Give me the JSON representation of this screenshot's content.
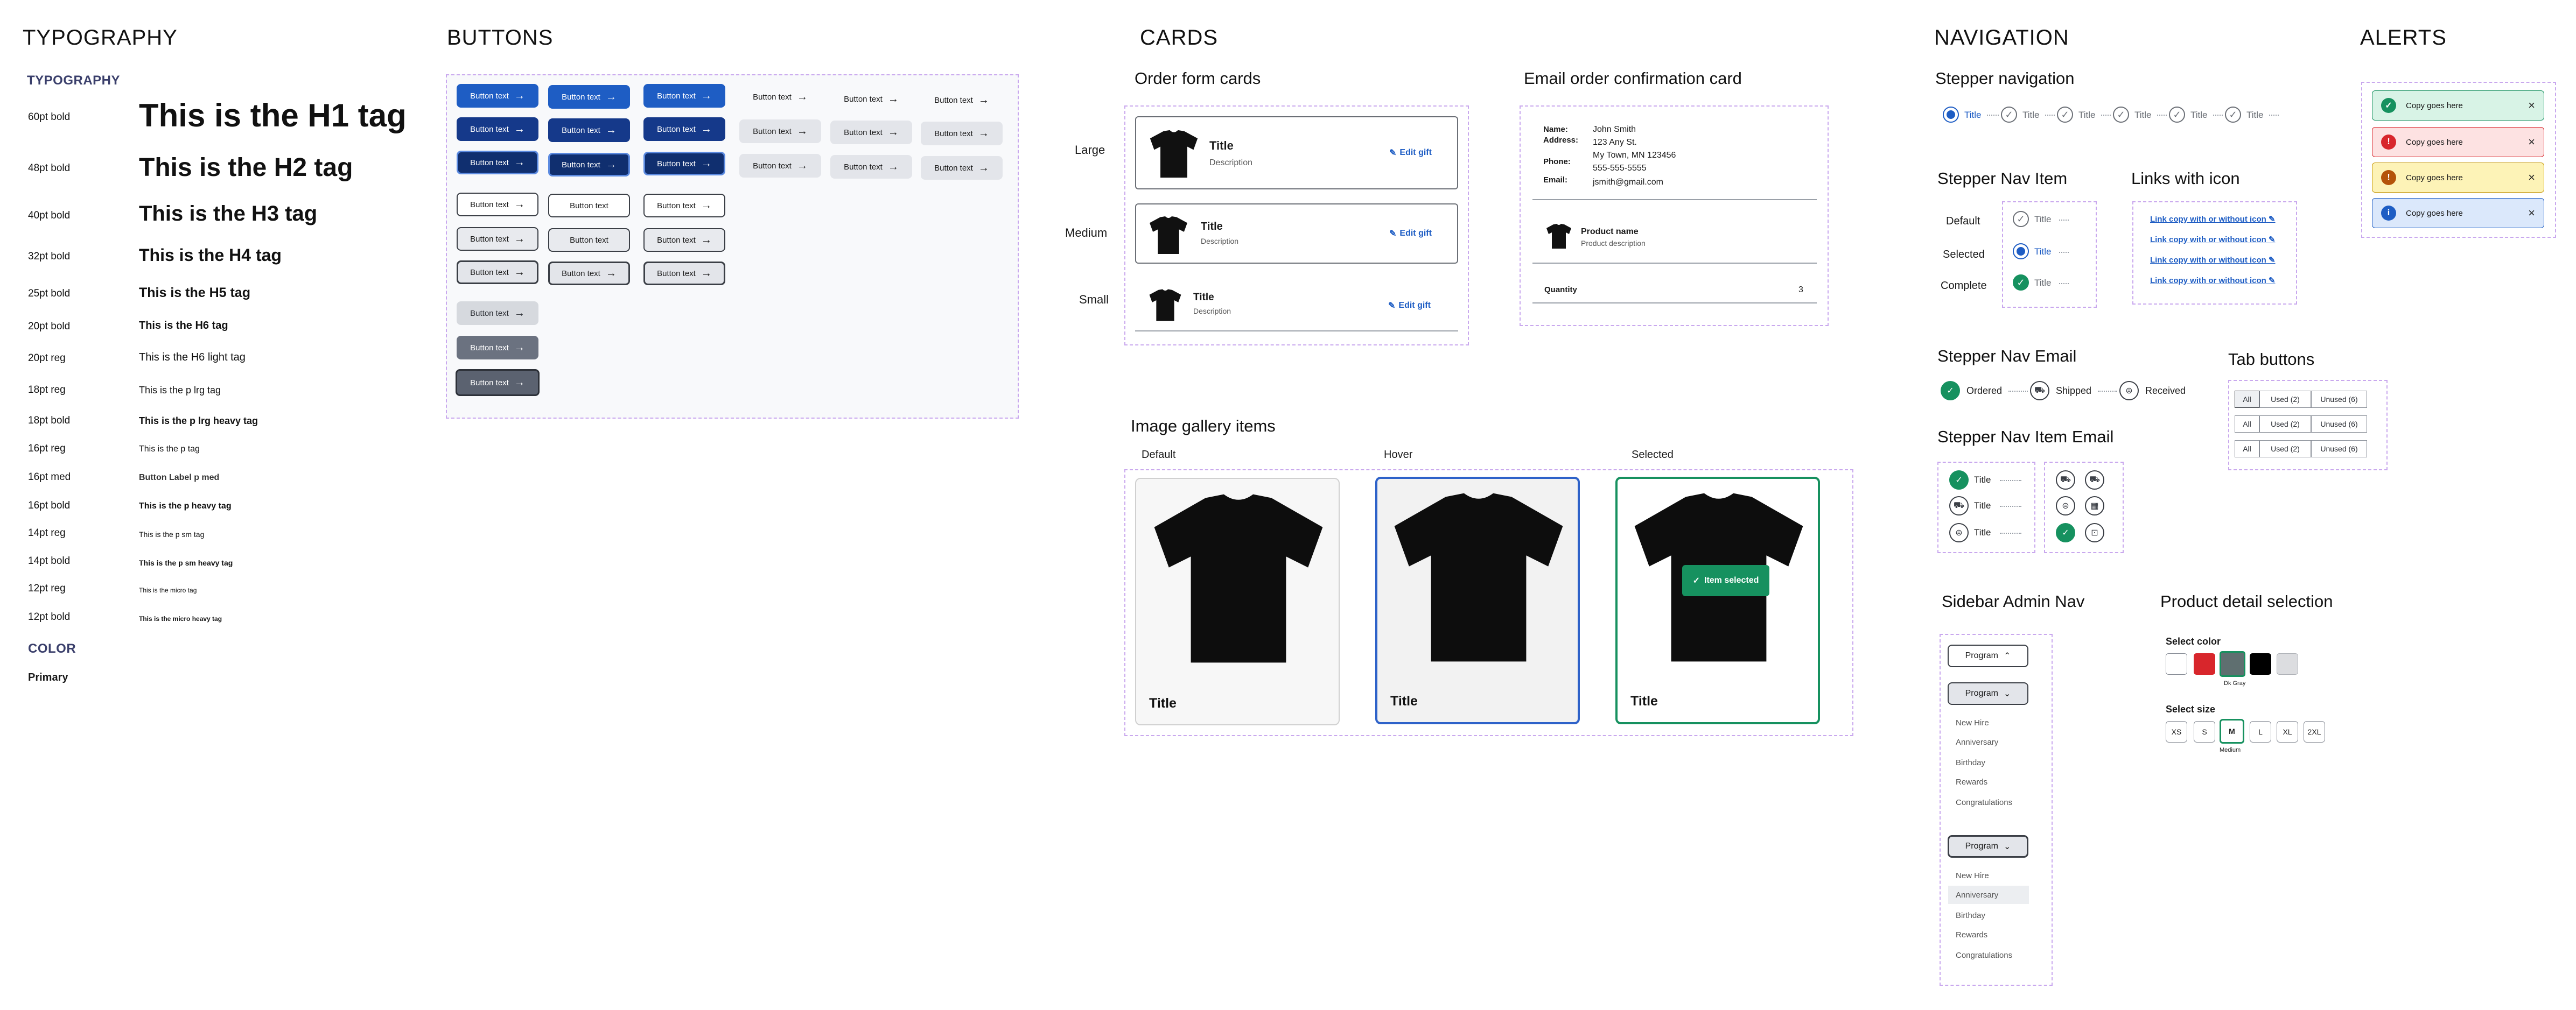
{
  "sections": {
    "typography": "TYPOGRAPHY",
    "buttons": "BUTTONS",
    "cards": "CARDS",
    "navigation": "NAVIGATION",
    "alerts": "ALERTS"
  },
  "typography": {
    "heading": "TYPOGRAPHY",
    "rows": [
      {
        "label": "60pt bold",
        "sample": "This is the H1 tag"
      },
      {
        "label": "48pt bold",
        "sample": "This is the H2 tag"
      },
      {
        "label": "40pt bold",
        "sample": "This is the H3 tag"
      },
      {
        "label": "32pt bold",
        "sample": "This is the H4 tag"
      },
      {
        "label": "25pt bold",
        "sample": "This is the H5 tag"
      },
      {
        "label": "20pt bold",
        "sample": "This is the H6 tag"
      },
      {
        "label": "20pt reg",
        "sample": "This is the H6 light tag"
      },
      {
        "label": "18pt reg",
        "sample": "This is the p lrg tag"
      },
      {
        "label": "18pt bold",
        "sample": "This is the p lrg heavy tag"
      },
      {
        "label": "16pt reg",
        "sample": "This is the p tag"
      },
      {
        "label": "16pt med",
        "sample": "Button Label p med"
      },
      {
        "label": "16pt bold",
        "sample": "This is the p heavy tag"
      },
      {
        "label": "14pt reg",
        "sample": "This is the p sm tag"
      },
      {
        "label": "14pt bold",
        "sample": "This is the p sm heavy tag"
      },
      {
        "label": "12pt reg",
        "sample": "This is the micro tag"
      },
      {
        "label": "12pt bold",
        "sample": "This is the micro heavy tag"
      }
    ],
    "color_heading": "COLOR",
    "primary_label": "Primary"
  },
  "buttons": {
    "label": "Button text"
  },
  "cards": {
    "order_form_title": "Order form cards",
    "sizes": [
      "Large",
      "Medium",
      "Small"
    ],
    "item_title": "Title",
    "item_desc": "Description",
    "edit_gift": "Edit gift",
    "email_title": "Email order confirmation card",
    "email": {
      "name_label": "Name:",
      "address_label": "Address:",
      "phone_label": "Phone:",
      "email_label": "Email:",
      "name": "John Smith",
      "address1": "123 Any St.",
      "address2": "My Town, MN 123456",
      "phone": "555-555-5555",
      "email": "jsmith@gmail.com",
      "product_name": "Product name",
      "product_desc": "Product description",
      "quantity_label": "Quantity",
      "quantity_value": "3"
    },
    "gallery_title": "Image gallery items",
    "gallery_states": [
      "Default",
      "Hover",
      "Selected"
    ],
    "gallery_item_title": "Title",
    "item_selected": "Item selected"
  },
  "navigation": {
    "stepper_title": "Stepper navigation",
    "step_label": "Title",
    "nav_item_title": "Stepper Nav Item",
    "nav_item_states": [
      "Default",
      "Selected",
      "Complete"
    ],
    "links_title": "Links with icon",
    "link_text": "Link copy with or without icon",
    "email_title": "Stepper Nav Email",
    "email_steps": [
      "Ordered",
      "Shipped",
      "Received"
    ],
    "tab_title": "Tab buttons",
    "tabs": [
      "All",
      "Used (2)",
      "Unused (6)"
    ],
    "item_email_title": "Stepper Nav Item Email",
    "sidebar_title": "Sidebar Admin Nav",
    "program_label": "Program",
    "sidebar_items": [
      "New Hire",
      "Anniversary",
      "Birthday",
      "Rewards",
      "Congratulations"
    ],
    "product_title": "Product detail selection",
    "select_color": "Select color",
    "color_selected_label": "Dk Gray",
    "select_size": "Select size",
    "sizes": [
      "XS",
      "S",
      "M",
      "L",
      "XL",
      "2XL"
    ],
    "size_selected_label": "Medium"
  },
  "alerts": {
    "text": "Copy goes here"
  },
  "colors": {
    "primary": "#1e5dc4",
    "success": "#16915f",
    "error": "#d8262c",
    "warning": "#b45309",
    "info": "#1e5dc4"
  }
}
